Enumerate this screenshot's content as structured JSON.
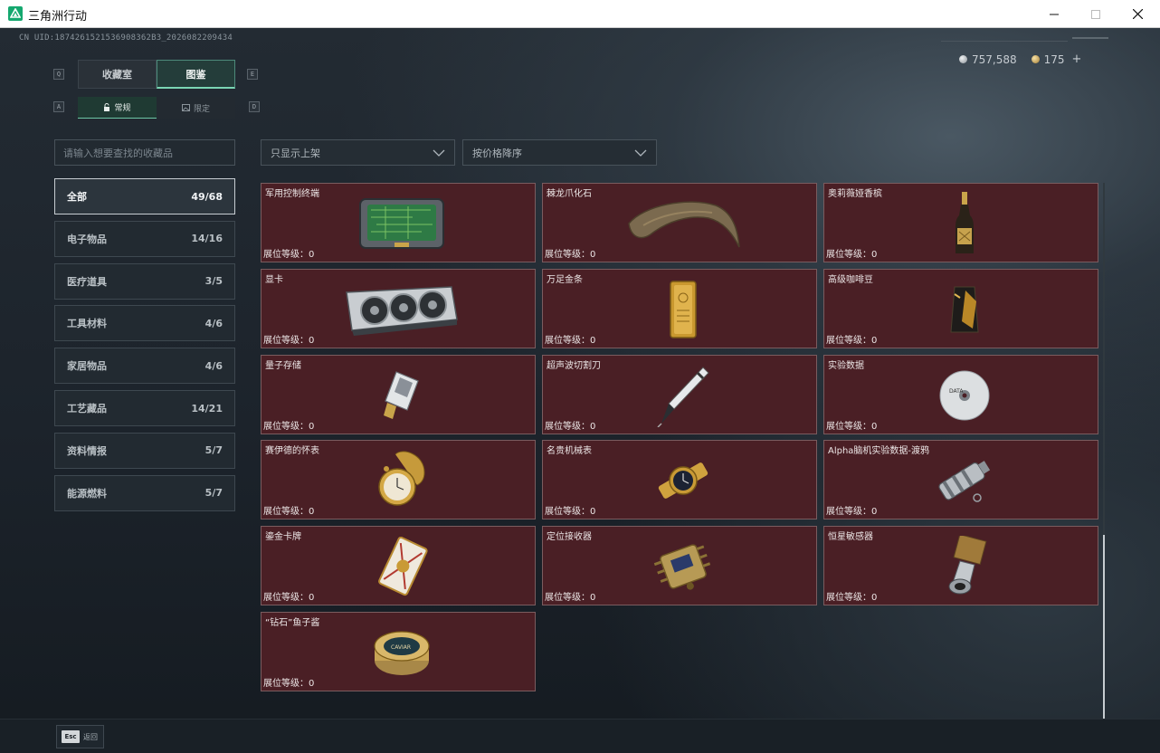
{
  "window": {
    "title": "三角洲行动"
  },
  "header": {
    "uid": "CN UID:1874261521536908362B3_2026082209434",
    "currency": [
      {
        "icon": "silver-coin-icon",
        "value": "757,588",
        "color": "#b9bfc4"
      },
      {
        "icon": "gold-coin-icon",
        "value": "175",
        "suffix": "+",
        "color": "#d6b36a"
      }
    ]
  },
  "keys": {
    "prev_tab": "Q",
    "next_tab": "E",
    "prev_sub": "A",
    "next_sub": "D"
  },
  "tabs": [
    {
      "label": "收藏室",
      "active": false
    },
    {
      "label": "图鉴",
      "active": true
    }
  ],
  "subtabs": [
    {
      "label": "常规",
      "icon": "lock-open-icon",
      "active": true
    },
    {
      "label": "限定",
      "icon": "image-icon",
      "active": false
    }
  ],
  "search": {
    "placeholder": "请输入想要查找的收藏品"
  },
  "categories": [
    {
      "label": "全部",
      "count": "49/68",
      "active": true
    },
    {
      "label": "电子物品",
      "count": "14/16"
    },
    {
      "label": "医疗道具",
      "count": "3/5"
    },
    {
      "label": "工具材料",
      "count": "4/6"
    },
    {
      "label": "家居物品",
      "count": "4/6"
    },
    {
      "label": "工艺藏品",
      "count": "14/21"
    },
    {
      "label": "资料情报",
      "count": "5/7"
    },
    {
      "label": "能源燃料",
      "count": "5/7"
    }
  ],
  "filters": {
    "display": "只显示上架",
    "sort": "按价格降序"
  },
  "items": [
    {
      "name": "军用控制终端",
      "level": "展位等级：0",
      "icon": "military-terminal-icon"
    },
    {
      "name": "棘龙爪化石",
      "level": "展位等级：0",
      "icon": "dinosaur-claw-icon"
    },
    {
      "name": "奥莉薇娅香槟",
      "level": "展位等级：0",
      "icon": "champagne-bottle-icon"
    },
    {
      "name": "显卡",
      "level": "展位等级：0",
      "icon": "graphics-card-icon"
    },
    {
      "name": "万足金条",
      "level": "展位等级：0",
      "icon": "gold-bar-icon"
    },
    {
      "name": "高级咖啡豆",
      "level": "展位等级：0",
      "icon": "coffee-bag-icon"
    },
    {
      "name": "量子存储",
      "level": "展位等级：0",
      "icon": "quantum-storage-icon"
    },
    {
      "name": "超声波切割刀",
      "level": "展位等级：0",
      "icon": "ultrasonic-knife-icon"
    },
    {
      "name": "实验数据",
      "level": "展位等级：0",
      "icon": "disc-icon"
    },
    {
      "name": "赛伊德的怀表",
      "level": "展位等级：0",
      "icon": "pocket-watch-icon"
    },
    {
      "name": "名贵机械表",
      "level": "展位等级：0",
      "icon": "wristwatch-icon"
    },
    {
      "name": "Alpha脑机实验数据-渡鸦",
      "level": "展位等级：0",
      "icon": "data-cylinder-icon"
    },
    {
      "name": "鎏金卡牌",
      "level": "展位等级：0",
      "icon": "gilded-card-icon"
    },
    {
      "name": "定位接收器",
      "level": "展位等级：0",
      "icon": "receiver-icon"
    },
    {
      "name": "恒星敏感器",
      "level": "展位等级：0",
      "icon": "star-sensor-icon"
    },
    {
      "name": "“钻石”鱼子酱",
      "level": "展位等级：0",
      "icon": "caviar-tin-icon"
    }
  ],
  "footer": {
    "esc_key": "Esc",
    "back_label": "返回"
  }
}
